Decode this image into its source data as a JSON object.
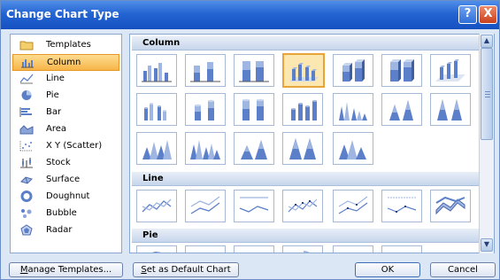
{
  "dialog": {
    "title": "Change Chart Type",
    "help_button": "?",
    "close_button": "X"
  },
  "chart_types": [
    {
      "label": "Templates",
      "icon": "folder-icon"
    },
    {
      "label": "Column",
      "icon": "column-chart-icon",
      "selected": true
    },
    {
      "label": "Line",
      "icon": "line-chart-icon"
    },
    {
      "label": "Pie",
      "icon": "pie-chart-icon"
    },
    {
      "label": "Bar",
      "icon": "bar-chart-icon"
    },
    {
      "label": "Area",
      "icon": "area-chart-icon"
    },
    {
      "label": "X Y (Scatter)",
      "icon": "scatter-chart-icon"
    },
    {
      "label": "Stock",
      "icon": "stock-chart-icon"
    },
    {
      "label": "Surface",
      "icon": "surface-chart-icon"
    },
    {
      "label": "Doughnut",
      "icon": "doughnut-chart-icon"
    },
    {
      "label": "Bubble",
      "icon": "bubble-chart-icon"
    },
    {
      "label": "Radar",
      "icon": "radar-chart-icon"
    }
  ],
  "gallery": {
    "sections": [
      {
        "label": "Column"
      },
      {
        "label": "Line"
      },
      {
        "label": "Pie"
      }
    ],
    "selected_subtype": "3-D Clustered Column"
  },
  "buttons": {
    "manage_templates_mnemonic": "M",
    "manage_templates_rest": "anage Templates...",
    "set_default_mnemonic": "S",
    "set_default_rest": "et as Default Chart",
    "ok": "OK",
    "cancel": "Cancel"
  },
  "colors": {
    "title_bar": "#2464d2",
    "selection": "#f7b54a",
    "chart_blue": "#5b7fc9"
  }
}
